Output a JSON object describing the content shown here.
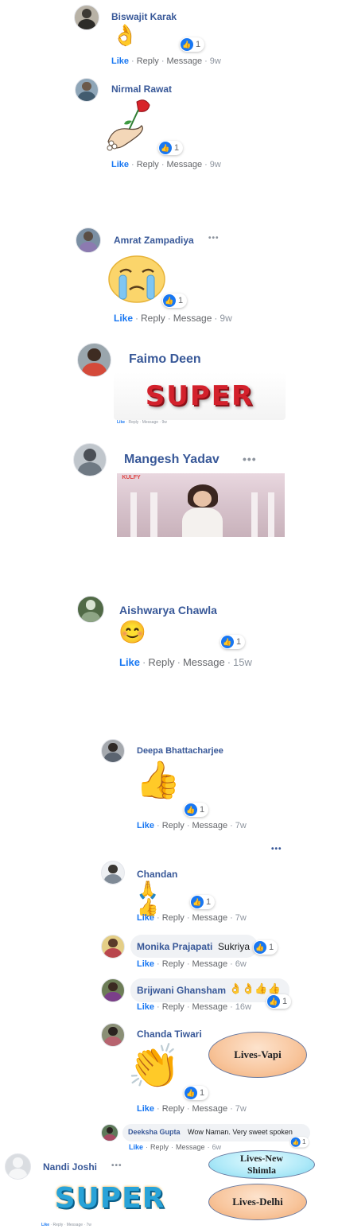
{
  "colors": {
    "link": "#385898",
    "like_blue": "#1877f2",
    "meta_gray": "#8d949e",
    "bubble_bg": "#f0f2f5"
  },
  "icons": {
    "like": "like-thumb-icon",
    "more": "more-dots-icon"
  },
  "actions": {
    "like": "Like",
    "reply": "Reply",
    "message": "Message"
  },
  "comments": [
    {
      "name": "Biswajit Karak",
      "emoji": "👌",
      "reactions": "1",
      "time": "9w"
    },
    {
      "name": "Nirmal Rawat",
      "sticker": "hand-with-rose-sticker",
      "reactions": "1",
      "time": "9w"
    },
    {
      "name": "Amrat Zampadiya",
      "more": "•••",
      "sticker": "crying-face-sticker",
      "reactions": "1",
      "time": "9w"
    },
    {
      "name": "Faimo Deen",
      "sticker_text": "SUPER",
      "time": "9w"
    },
    {
      "name": "Mangesh Yadav",
      "more": "•••",
      "gif_logo": "KULFY"
    },
    {
      "name": "Aishwarya Chawla",
      "emoji": "😊",
      "reactions": "1",
      "time": "15w"
    },
    {
      "name": "Deepa Bhattacharjee",
      "emoji": "👍",
      "reactions": "1",
      "time": "7w"
    },
    {
      "name": "Chandan",
      "emoji": "🙏👍",
      "reactions": "1",
      "time": "7w"
    },
    {
      "name": "Monika Prajapati",
      "text": "Sukriya",
      "reactions": "1",
      "time": "6w"
    },
    {
      "name": "Brijwani Ghansham",
      "emoji": "👌👌👍👍",
      "reactions": "1",
      "time": "16w"
    },
    {
      "name": "Chanda Tiwari",
      "emoji": "👏",
      "reactions": "1",
      "time": "7w"
    },
    {
      "name": "Deeksha Gupta",
      "text": "Wow Naman. Very sweet spoken",
      "reactions": "1",
      "time": "6w"
    },
    {
      "name": "Nandi Joshi",
      "more": "•••",
      "sticker_text": "SUPER",
      "time": "7w"
    }
  ],
  "thread_more": "•••",
  "callouts": {
    "vapi": "Lives-Vapi",
    "shimla_line1": "Lives-New",
    "shimla_line2": "Shimla",
    "delhi": "Lives-Delhi"
  }
}
